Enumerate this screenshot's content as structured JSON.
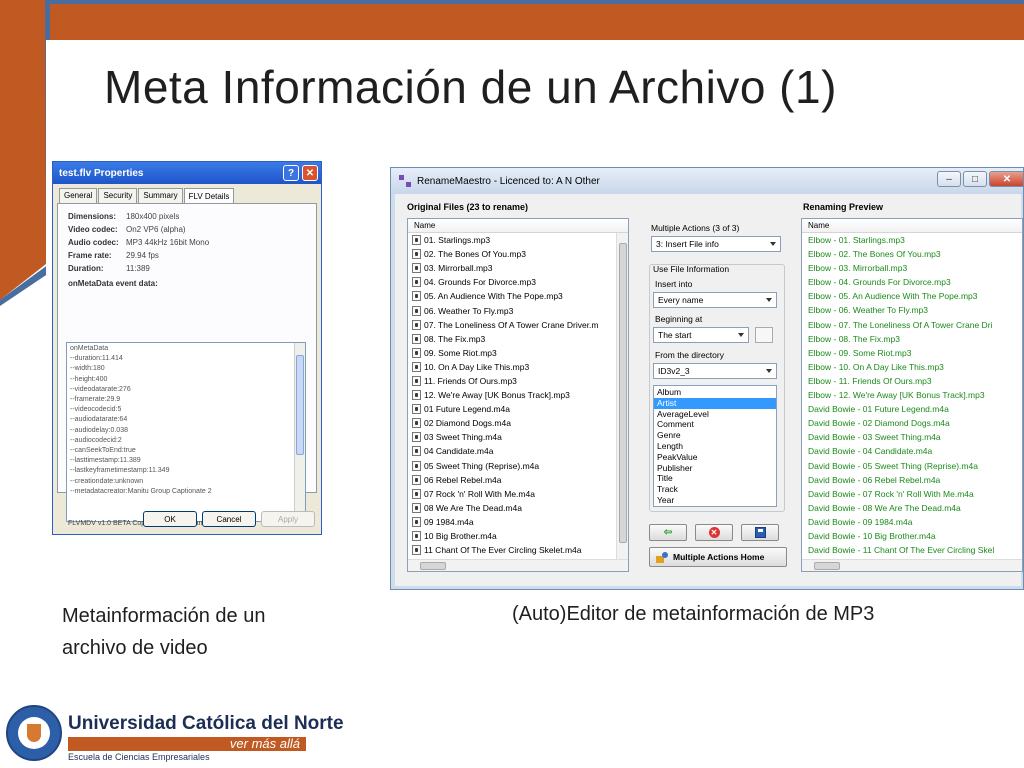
{
  "slide": {
    "title": "Meta Información de un Archivo (1)",
    "caption_left_line1": "Metainformación de un",
    "caption_left_line2": "archivo de video",
    "caption_right": "(Auto)Editor de metainformación de MP3",
    "accent_color": "#c05a22",
    "line_color": "#4a6da0"
  },
  "flv_dialog": {
    "title": "test.flv Properties",
    "tabs": [
      "General",
      "Security",
      "Summary",
      "FLV Details"
    ],
    "active_tab": "FLV Details",
    "details": [
      {
        "key": "Dimensions:",
        "value": "180x400 pixels"
      },
      {
        "key": "Video codec:",
        "value": "On2 VP6 (alpha)"
      },
      {
        "key": "Audio codec:",
        "value": "MP3 44kHz 16bit Mono"
      },
      {
        "key": "Frame rate:",
        "value": "29.94 fps"
      },
      {
        "key": "Duration:",
        "value": "11:389"
      }
    ],
    "event_label": "onMetaData event data:",
    "event_lines": [
      "onMetaData",
      "--duration:11.414",
      "--width:180",
      "--height:400",
      "--videodatarate:276",
      "--framerate:29.9",
      "--videocodecid:5",
      "--audiodatarate:64",
      "--audiodelay:0.038",
      "--audiocodecid:2",
      "--canSeekToEnd:true",
      "--lasttimestamp:11.389",
      "--lastkeyframetimestamp:11.349",
      "--creationdate:unknown",
      "--metadatacreator:Manitu Group Captionate 2"
    ],
    "footer": "FLVMDV v1.0 BETA Copyright © 2006 Manitu Group.",
    "ok_label": "OK",
    "cancel_label": "Cancel",
    "apply_label": "Apply"
  },
  "rename_maestro": {
    "title": "RenameMaestro - Licenced to: A N Other",
    "original_header": "Original Files (23 to rename)",
    "preview_header": "Renaming Preview",
    "column_name": "Name",
    "original_files": [
      "01. Starlings.mp3",
      "02. The Bones Of You.mp3",
      "03. Mirrorball.mp3",
      "04. Grounds For Divorce.mp3",
      "05. An Audience With The Pope.mp3",
      "06. Weather To Fly.mp3",
      "07. The Loneliness Of A Tower Crane Driver.m",
      "08. The Fix.mp3",
      "09. Some Riot.mp3",
      "10. On A Day Like This.mp3",
      "11. Friends Of Ours.mp3",
      "12. We're Away [UK Bonus Track].mp3",
      "01 Future Legend.m4a",
      "02 Diamond Dogs.m4a",
      "03 Sweet Thing.m4a",
      "04 Candidate.m4a",
      "05 Sweet Thing (Reprise).m4a",
      "06 Rebel Rebel.m4a",
      "07 Rock 'n' Roll With Me.m4a",
      "08 We Are The Dead.m4a",
      "09 1984.m4a",
      "10 Big Brother.m4a",
      "11 Chant Of The Ever Circling Skelet.m4a"
    ],
    "preview_files": [
      "Elbow - 01. Starlings.mp3",
      "Elbow - 02. The Bones Of You.mp3",
      "Elbow - 03. Mirrorball.mp3",
      "Elbow - 04. Grounds For Divorce.mp3",
      "Elbow - 05. An Audience With The Pope.mp3",
      "Elbow - 06. Weather To Fly.mp3",
      "Elbow - 07. The Loneliness Of A Tower Crane Dri",
      "Elbow - 08. The Fix.mp3",
      "Elbow - 09. Some Riot.mp3",
      "Elbow - 10. On A Day Like This.mp3",
      "Elbow - 11. Friends Of Ours.mp3",
      "Elbow - 12. We're Away [UK Bonus Track].mp3",
      "David Bowie - 01 Future Legend.m4a",
      "David Bowie - 02 Diamond Dogs.m4a",
      "David Bowie - 03 Sweet Thing.m4a",
      "David Bowie - 04 Candidate.m4a",
      "David Bowie - 05 Sweet Thing (Reprise).m4a",
      "David Bowie - 06 Rebel Rebel.m4a",
      "David Bowie - 07 Rock 'n' Roll With Me.m4a",
      "David Bowie - 08 We Are The Dead.m4a",
      "David Bowie - 09 1984.m4a",
      "David Bowie - 10 Big Brother.m4a",
      "David Bowie - 11 Chant Of The Ever Circling Skel"
    ],
    "multiple_actions_label": "Multiple Actions (3 of 3)",
    "multiple_actions_value": "3: Insert File info",
    "use_file_info_label": "Use File Information",
    "insert_into_label": "Insert into",
    "insert_into_value": "Every name",
    "beginning_at_label": "Beginning at",
    "beginning_at_value": "The start",
    "from_directory_label": "From the directory",
    "from_directory_value": "ID3v2_3",
    "fields": [
      "Album",
      "Artist",
      "AverageLevel",
      "Comment",
      "Genre",
      "Length",
      "PeakValue",
      "Publisher",
      "Title",
      "Track",
      "Year"
    ],
    "selected_field": "Artist",
    "home_label": "Multiple Actions Home",
    "preview_color": "#1b8a1b",
    "selection_color": "#3399ff"
  },
  "logo": {
    "name": "Universidad Católica del Norte",
    "motto": "ver más allá",
    "dept": "Escuela de Ciencias Empresariales"
  }
}
